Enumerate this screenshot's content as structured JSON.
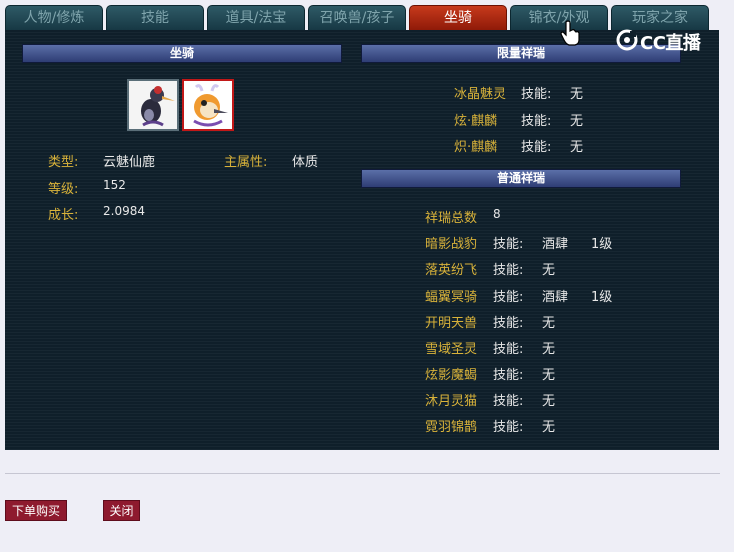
{
  "tabs": [
    {
      "label": "人物/修炼"
    },
    {
      "label": "技能"
    },
    {
      "label": "道具/法宝"
    },
    {
      "label": "召唤兽/孩子"
    },
    {
      "label": "坐骑",
      "active": true
    },
    {
      "label": "锦衣/外观"
    },
    {
      "label": "玩家之家"
    }
  ],
  "watermark": {
    "text": "CC直播"
  },
  "mount": {
    "header": "坐骑",
    "type_label": "类型:",
    "type_value": "云魅仙鹿",
    "attr_label": "主属性:",
    "attr_value": "体质",
    "level_label": "等级:",
    "level_value": "152",
    "growth_label": "成长:",
    "growth_value": "2.0984"
  },
  "limited": {
    "header": "限量祥瑞",
    "items": [
      {
        "name": "冰晶魅灵",
        "skill_label": "技能:",
        "skill": "无"
      },
      {
        "name": "炫·麒麟",
        "skill_label": "技能:",
        "skill": "无"
      },
      {
        "name": "炽·麒麟",
        "skill_label": "技能:",
        "skill": "无"
      }
    ]
  },
  "normal": {
    "header": "普通祥瑞",
    "total_label": "祥瑞总数",
    "total_value": "8",
    "items": [
      {
        "name": "暗影战豹",
        "skill_label": "技能:",
        "skill": "酒肆",
        "level": "1级"
      },
      {
        "name": "落英纷飞",
        "skill_label": "技能:",
        "skill": "无",
        "level": ""
      },
      {
        "name": "蝠翼冥骑",
        "skill_label": "技能:",
        "skill": "酒肆",
        "level": "1级"
      },
      {
        "name": "开明天兽",
        "skill_label": "技能:",
        "skill": "无",
        "level": ""
      },
      {
        "name": "雪域圣灵",
        "skill_label": "技能:",
        "skill": "无",
        "level": ""
      },
      {
        "name": "炫影魔蝎",
        "skill_label": "技能:",
        "skill": "无",
        "level": ""
      },
      {
        "name": "沐月灵猫",
        "skill_label": "技能:",
        "skill": "无",
        "level": ""
      },
      {
        "name": "霓羽锦鹊",
        "skill_label": "技能:",
        "skill": "无",
        "level": ""
      }
    ]
  },
  "buttons": {
    "buy": "下单购买",
    "close": "关闭"
  }
}
